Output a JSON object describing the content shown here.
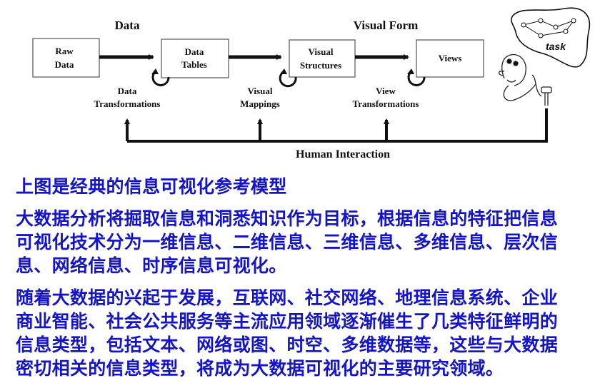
{
  "diagram": {
    "stage_titles": {
      "data": "Data",
      "visual_form": "Visual Form"
    },
    "boxes": {
      "raw_data": [
        "Raw",
        "Data"
      ],
      "data_tables": [
        "Data",
        "Tables"
      ],
      "visual_structures": [
        "Visual",
        "Structures"
      ],
      "views": [
        "Views"
      ]
    },
    "transforms": {
      "data_transformations": [
        "Data",
        "Transformations"
      ],
      "visual_mappings": [
        "Visual",
        "Mappings"
      ],
      "view_transformations": [
        "View",
        "Transformations"
      ]
    },
    "feedback_label": "Human Interaction",
    "task_label": "task"
  },
  "text": {
    "caption": "上图是经典的信息可视化参考模型",
    "para1": [
      "大数据分析将掘取信息和洞悉知识作为目标，根据信息的特征把信息",
      "可视化技术分为一维信息、二维信息、三维信息、多维信息、层次信",
      "息、网络信息、时序信息可视化。"
    ],
    "para2": [
      "随着大数据的兴起于发展，互联网、社交网络、地理信息系统、企业",
      "商业智能、社会公共服务等主流应用领域逐渐催生了几类特征鲜明的",
      "信息类型，包括文本、网络或图、时空、多维数据等，这些与大数据",
      "密切相关的信息类型，将成为大数据可视化的主要研究领域。"
    ]
  },
  "colors": {
    "text": "#1414c8",
    "diagram": "#111111"
  }
}
